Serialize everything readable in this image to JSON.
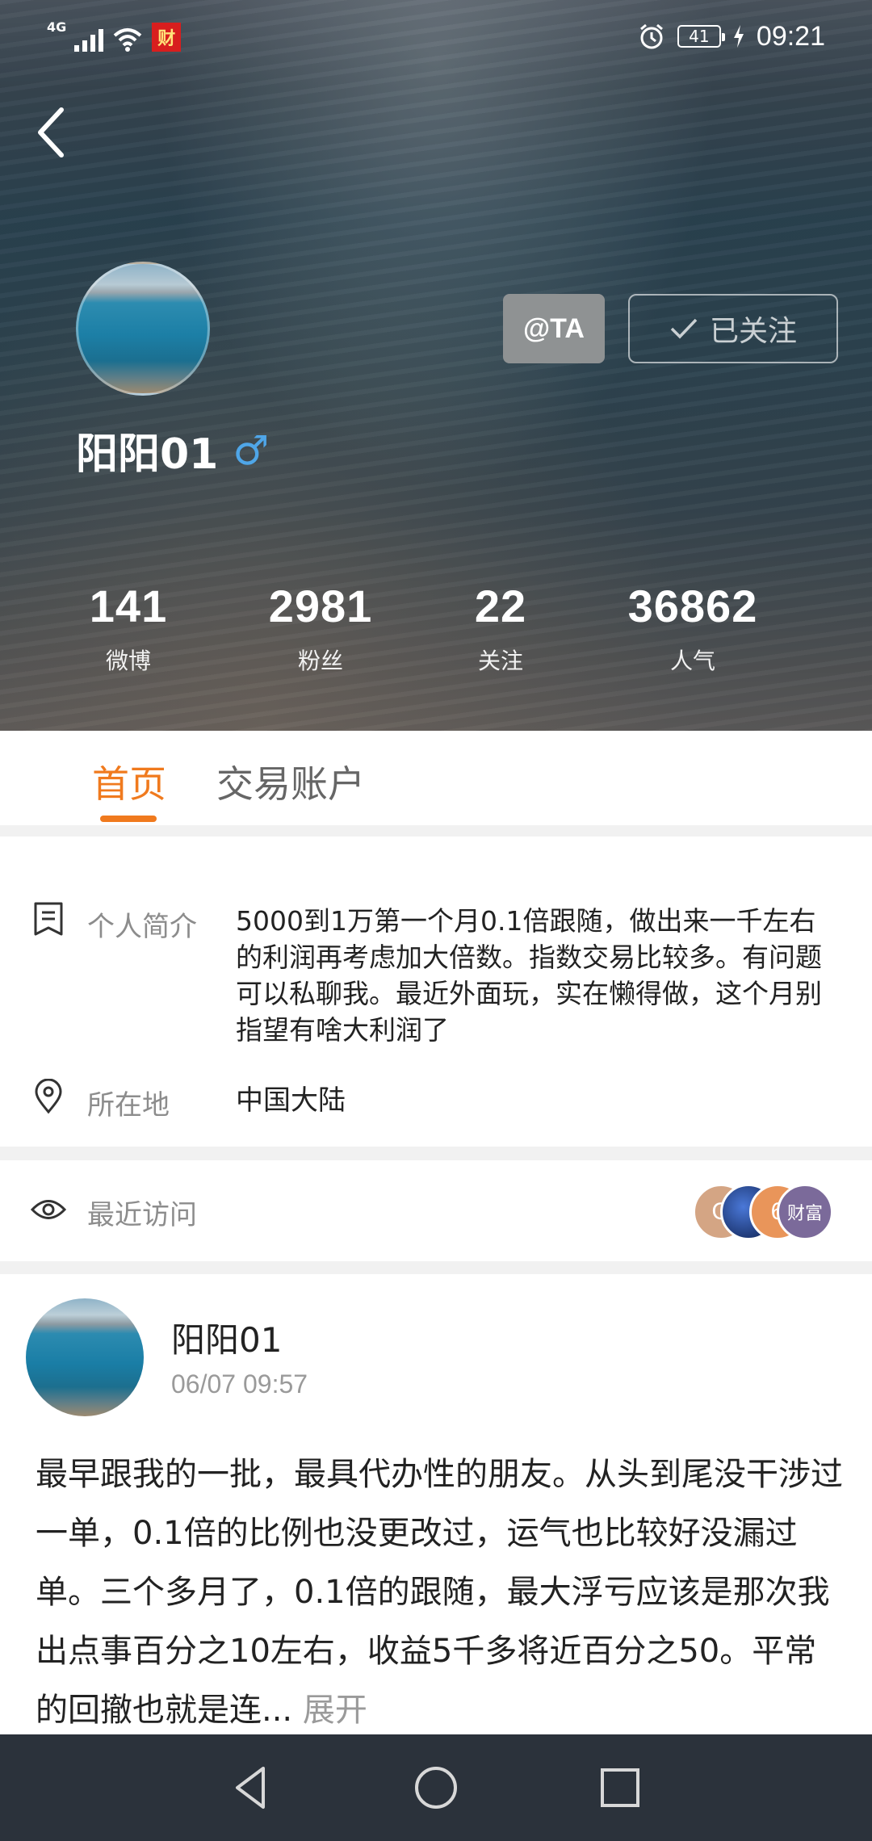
{
  "status_bar": {
    "network": "4G",
    "battery": "41",
    "time": "09:21"
  },
  "profile": {
    "at_button": "@TA",
    "follow_button": "已关注",
    "name": "阳阳01",
    "gender_symbol": "♂",
    "gender_color": "#4fa6e8"
  },
  "stats": [
    {
      "value": "141",
      "label": "微博"
    },
    {
      "value": "2981",
      "label": "粉丝"
    },
    {
      "value": "22",
      "label": "关注"
    },
    {
      "value": "36862",
      "label": "人气"
    }
  ],
  "tabs": [
    {
      "label": "首页",
      "active": true
    },
    {
      "label": "交易账户",
      "active": false
    }
  ],
  "accent_color": "#f07a1e",
  "info": {
    "bio_label": "个人简介",
    "bio_text": "5000到1万第一个月0.1倍跟随，做出来一千左右的利润再考虑加大倍数。指数交易比较多。有问题可以私聊我。最近外面玩，实在懒得做，这个月别指望有啥大利润了",
    "location_label": "所在地",
    "location_value": "中国大陆",
    "recent_visits_label": "最近访问"
  },
  "recent_visitors": [
    {
      "initial": "G",
      "color": "#d4a584"
    },
    {
      "initial": "",
      "color": "#1f3f8f"
    },
    {
      "initial": "6",
      "color": "#e9955a"
    },
    {
      "initial": "财富",
      "color": "#7b6a9a"
    }
  ],
  "post": {
    "author": "阳阳01",
    "time": "06/07 09:57",
    "text": "最早跟我的一批，最具代办性的朋友。从头到尾没干涉过一单，0.1倍的比例也没更改过，运气也比较好没漏过单。三个多月了，0.1倍的跟随，最大浮亏应该是那次我出点事百分之10左右，收益5千多将近百分之50。平常的回撤也就是连...",
    "expand_label": "展开"
  }
}
